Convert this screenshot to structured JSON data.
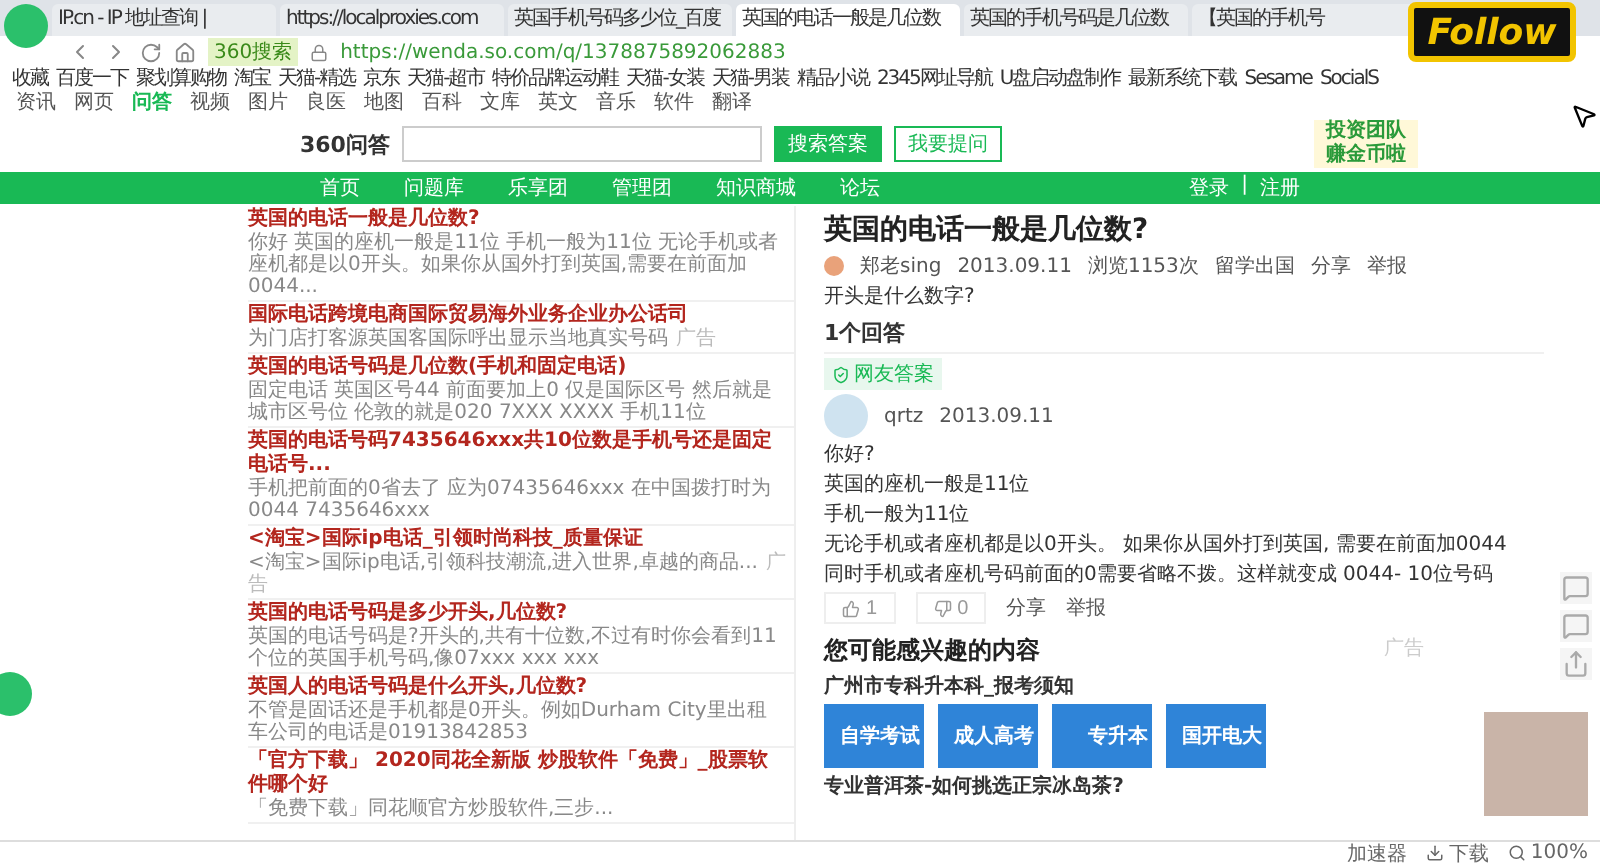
{
  "browser": {
    "tabs": [
      {
        "label": "IP.cn - IP 地址查询 |",
        "selected": false
      },
      {
        "label": "https://localproxies.com",
        "selected": false
      },
      {
        "label": "英国手机号码多少位_百度",
        "selected": false
      },
      {
        "label": "英国的电话一般是几位数",
        "selected": true
      },
      {
        "label": "英国的手机号码是几位数",
        "selected": false
      },
      {
        "label": "【英国的手机号",
        "selected": false
      }
    ],
    "search_engine": "360搜索",
    "url": "https://wenda.so.com/q/1378875892062883",
    "bookmarks": [
      "收藏",
      "百度一下",
      "聚划算购物",
      "淘宝",
      "天猫-精选",
      "京东",
      "天猫-超市",
      "特价品牌运动鞋",
      "天猫-女装",
      "天猫-男装",
      "精品小说",
      "2345网址导航",
      "U盘启动盘制作",
      "最新系统下载",
      "Sesame",
      "SocialS"
    ],
    "verticals": [
      {
        "label": "资讯",
        "selected": false
      },
      {
        "label": "网页",
        "selected": false
      },
      {
        "label": "问答",
        "selected": true
      },
      {
        "label": "视频",
        "selected": false
      },
      {
        "label": "图片",
        "selected": false
      },
      {
        "label": "良医",
        "selected": false
      },
      {
        "label": "地图",
        "selected": false
      },
      {
        "label": "百科",
        "selected": false
      },
      {
        "label": "文库",
        "selected": false
      },
      {
        "label": "英文",
        "selected": false
      },
      {
        "label": "音乐",
        "selected": false
      },
      {
        "label": "软件",
        "selected": false
      },
      {
        "label": "翻译",
        "selected": false
      }
    ]
  },
  "follow_badge": "Follow",
  "site": {
    "logo": "360问答",
    "search_button": "搜索答案",
    "ask_button": "我要提问",
    "ad_lines": [
      "投资团队",
      "赚金币啦"
    ],
    "nav": [
      "首页",
      "问题库",
      "乐享团",
      "管理团",
      "知识商城",
      "论坛"
    ],
    "login": "登录",
    "separator": "|",
    "register": "注册"
  },
  "related": [
    {
      "title": "英国的电话一般是几位数?",
      "desc": "你好 英国的座机一般是11位 手机一般为11位 无论手机或者座机都是以0开头。如果你从国外打到英国,需要在前面加0044..."
    },
    {
      "title": "国际电话跨境电商国际贸易海外业务企业办公话司",
      "desc": "为门店打客源英国客国际呼出显示当地真实号码",
      "tag": "广告"
    },
    {
      "title": "英国的电话号码是几位数(手机和固定电话)",
      "desc": "固定电话 英国区号44 前面要加上0 仅是国际区号 然后就是城市区号位 伦敦的就是020 7XXX XXXX 手机11位"
    },
    {
      "title": "英国的电话号码7435646xxx共10位数是手机号还是固定电话号...",
      "desc": "手机把前面的0省去了 应为07435646xxx 在中国拨打时为0044 7435646xxx"
    },
    {
      "title": "<淘宝>国际ip电话_引领时尚科技_质量保证",
      "desc": "<淘宝>国际ip电话,引领科技潮流,进入世界,卓越的商品...",
      "tag": "广告"
    },
    {
      "title": "英国的电话号码是多少开头,几位数?",
      "desc": "英国的电话号码是?开头的,共有十位数,不过有时你会看到11个位的英国手机号码,像07xxx xxx xxx"
    },
    {
      "title": "英国人的电话号码是什么开头,几位数?",
      "desc": "不管是固话还是手机都是0开头。例如Durham City里出租车公司的电话是01913842853"
    },
    {
      "title": "「官方下载」 2020同花全新版 炒股软件「免费」_股票软件哪个好",
      "desc": "「免费下载」同花顺官方炒股软件,三步..."
    }
  ],
  "question": {
    "title": "英国的电话一般是几位数?",
    "author": "郑老sing",
    "date": "2013.09.11",
    "views": "浏览1153次",
    "category": "留学出国",
    "share": "分享",
    "report": "举报",
    "body": "开头是什么数字?"
  },
  "answers_count": "1个回答",
  "answer": {
    "badge": "网友答案",
    "user": "qrtz",
    "date": "2013.09.11",
    "lines": [
      "你好?",
      "英国的座机一般是11位",
      "手机一般为11位",
      "无论手机或者座机都是以0开头。 如果你从国外打到英国, 需要在前面加0044",
      "同时手机或者座机号码前面的0需要省略不拨。这样就变成 0044- 10位号码"
    ],
    "likes": "1",
    "dislikes": "0",
    "share": "分享",
    "report": "举报"
  },
  "interest": {
    "title": "您可能感兴趣的内容",
    "ad": "广告",
    "subtitle": "广州市专科升本科_报考须知",
    "banners": [
      "自学考试",
      "成人高考",
      "专升本",
      "国开电大"
    ],
    "next_title": "专业普洱茶-如何挑选正宗冰岛茶?"
  },
  "status_bar": {
    "accelerator": "加速器",
    "download": "下载",
    "zoom": "100%"
  }
}
